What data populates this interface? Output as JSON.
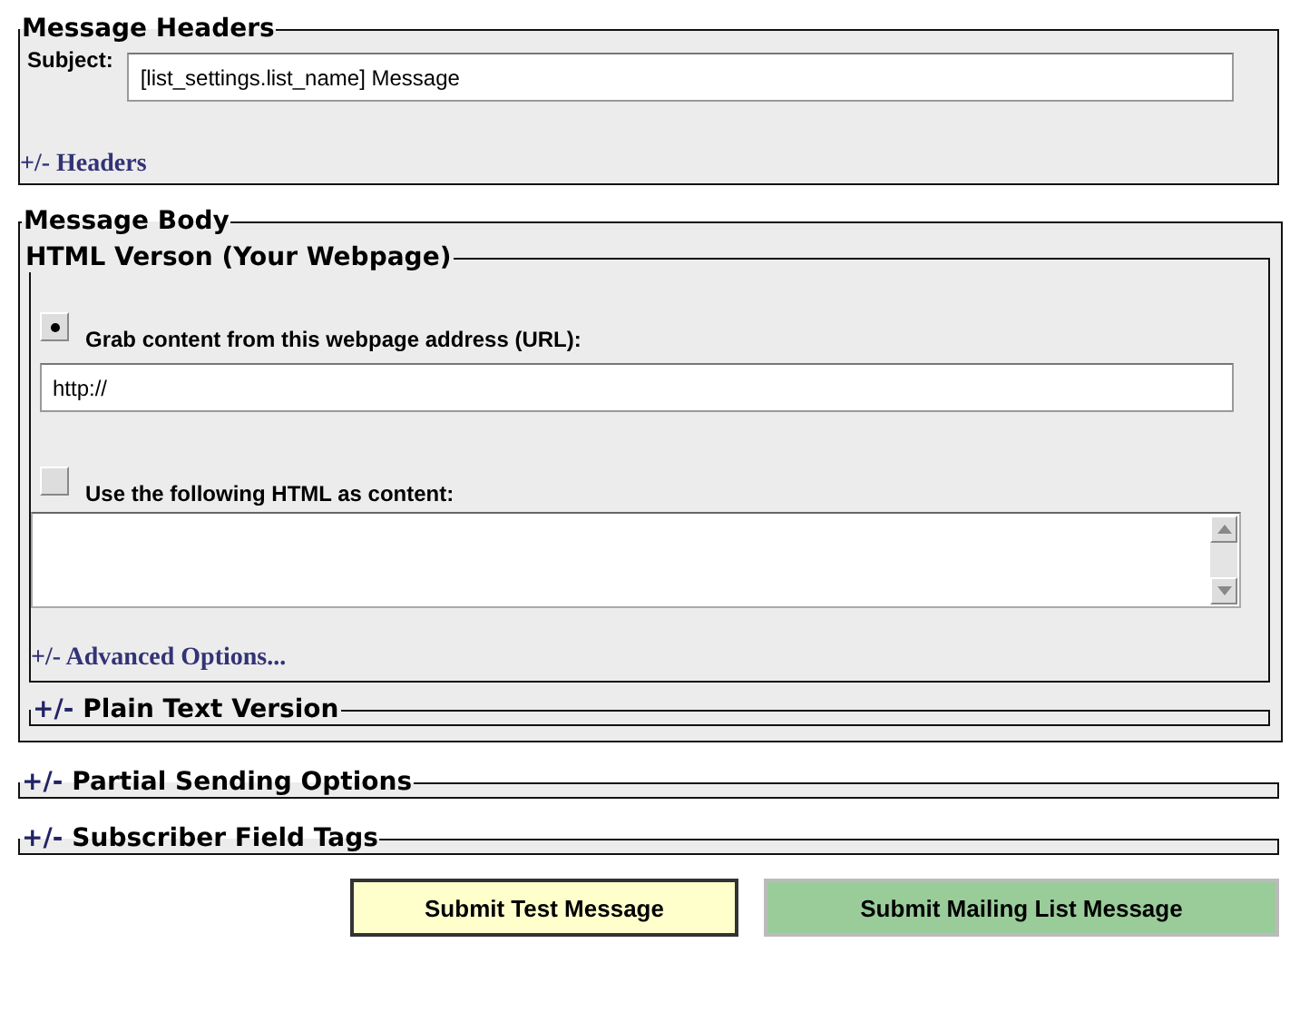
{
  "headers": {
    "title": "Message Headers",
    "subject_label": "Subject:",
    "subject_value": "[list_settings.list_name] Message",
    "toggle_link": "+/- Headers"
  },
  "body": {
    "title": "Message Body",
    "html_version": {
      "title": "HTML Verson (Your Webpage)",
      "options": [
        {
          "label": "Grab content from this webpage address (URL):",
          "selected": true,
          "kind": "input",
          "value": "http://"
        },
        {
          "label": "Use the following HTML as content:",
          "selected": false,
          "kind": "textarea"
        }
      ],
      "advanced_link": "+/- Advanced Options..."
    },
    "plain_text": {
      "toggle": "+/-",
      "title": "Plain Text Version"
    }
  },
  "collapsed_sections": [
    {
      "toggle": "+/-",
      "title": "Partial Sending Options"
    },
    {
      "toggle": "+/-",
      "title": "Subscriber Field Tags"
    }
  ],
  "buttons": [
    {
      "label": "Submit Test Message",
      "kind": "test"
    },
    {
      "label": "Submit Mailing List Message",
      "kind": "send"
    }
  ]
}
